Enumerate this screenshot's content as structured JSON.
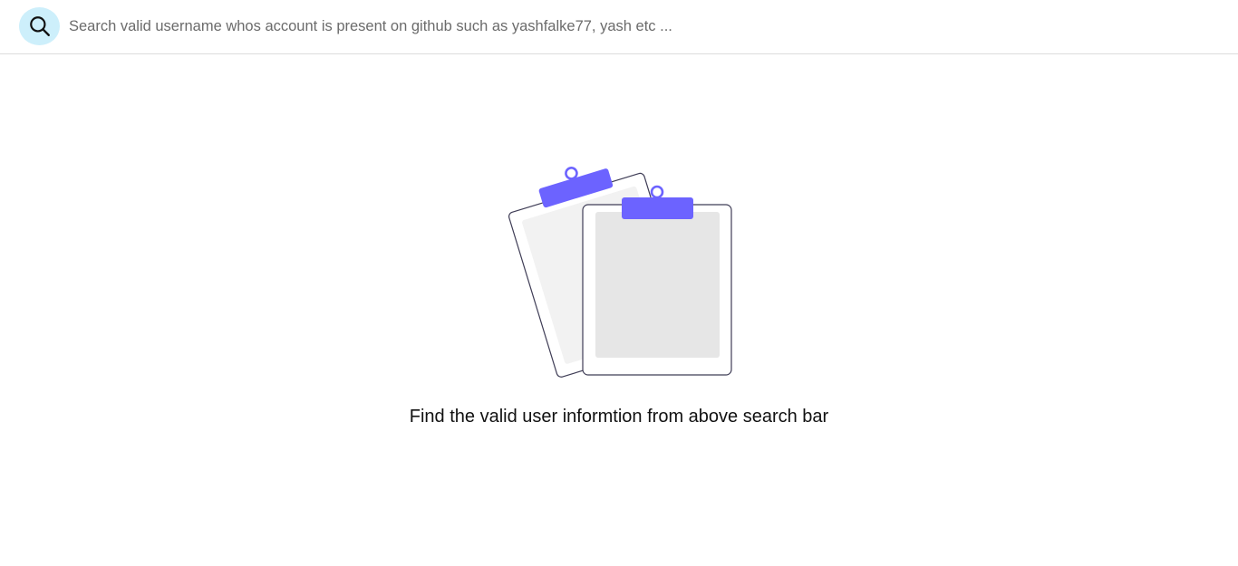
{
  "header": {
    "search_icon": "search-icon",
    "search_placeholder": "Search valid username whos account is present on github such as yashfalke77, yash etc ...",
    "search_value": ""
  },
  "empty_state": {
    "illustration": "clipboards-illustration",
    "message": "Find the valid user informtion from above search bar"
  },
  "colors": {
    "accent": "#6c63ff",
    "search_button_bg": "#cdeffb",
    "clipboard_back_fill": "#f2f2f2",
    "clipboard_front_fill": "#e6e6e6",
    "outline": "#3f3d56"
  }
}
